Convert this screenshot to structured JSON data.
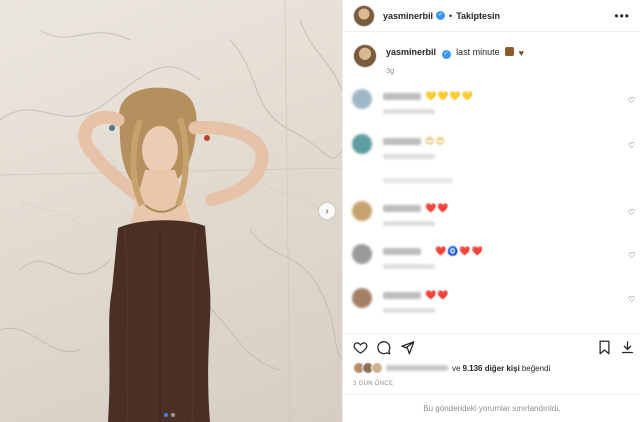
{
  "post": {
    "username": "yasminerbil",
    "follow_state": "Takiptesin",
    "separator": "•",
    "more_label": "•••",
    "caption": "last minute",
    "caption_time": "3g",
    "carousel_next": "›",
    "slide_count": 2,
    "active_slide": 1
  },
  "comments": {
    "items": [
      {
        "emoji": "💛💛💛💛",
        "avatar_color": "#9fb8c8"
      },
      {
        "emoji": "😍😍",
        "avatar_color": "#5f9ea0"
      },
      {
        "emoji": "❤️❤️",
        "avatar_color": "#c9a36d"
      },
      {
        "emoji": "❤️🧿❤️❤️",
        "avatar_color": "#9a9a9a"
      },
      {
        "emoji": "❤️❤️",
        "avatar_color": "#a57f65"
      }
    ],
    "like_icon": "heart-outline-icon"
  },
  "actions": {
    "like_icon": "heart-icon",
    "comment_icon": "comment-icon",
    "share_icon": "send-icon",
    "save_icon": "bookmark-icon",
    "download_icon": "download-icon"
  },
  "likes": {
    "connector": "ve",
    "count": "9.136 diğer kişi",
    "suffix": "beğendi"
  },
  "date": "3 GÜN ÖNCE",
  "footer": "Bu gönderideki yorumlar sınırlandırıldı.",
  "colors": {
    "accent": "#3897f0",
    "text": "#262626",
    "muted": "#8e8e8e"
  }
}
